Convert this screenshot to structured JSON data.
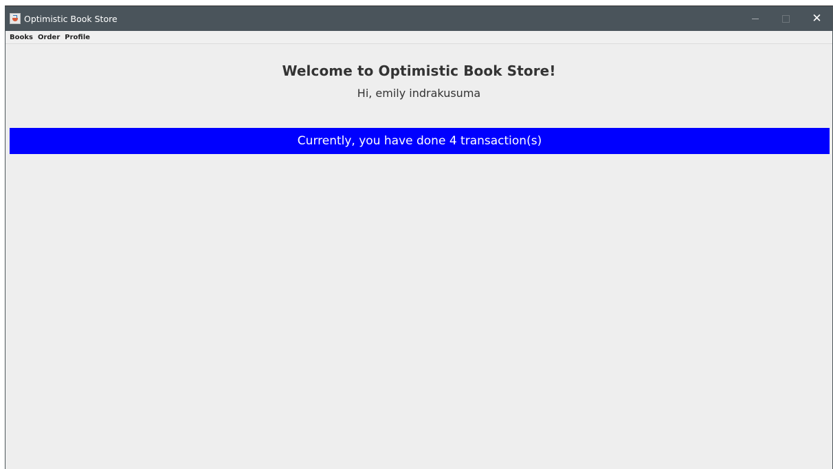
{
  "window": {
    "title": "Optimistic Book Store",
    "app_icon": "java-cup-icon",
    "controls": {
      "minimize_icon": "minimize-icon",
      "maximize_icon": "maximize-icon",
      "close_icon": "close-icon",
      "close_glyph": "✕"
    }
  },
  "menubar": {
    "items": [
      {
        "label": "Books"
      },
      {
        "label": "Order"
      },
      {
        "label": "Profile"
      }
    ]
  },
  "main": {
    "welcome_title": "Welcome to Optimistic Book Store!",
    "greeting": "Hi, emily indrakusuma",
    "transaction_banner": "Currently, you have done 4 transaction(s)"
  },
  "colors": {
    "titlebar_bg": "#4a545b",
    "content_bg": "#eeeeee",
    "banner_bg": "#0000ff",
    "banner_text": "#ffffff"
  }
}
